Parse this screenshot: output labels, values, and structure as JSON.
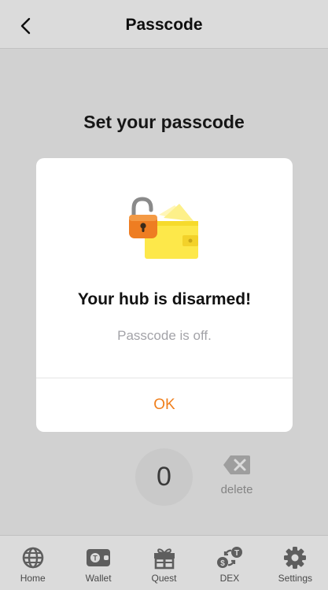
{
  "header": {
    "title": "Passcode",
    "back_icon": "chevron-left-icon"
  },
  "main": {
    "heading": "Set your passcode",
    "keypad": {
      "zero_label": "0",
      "delete_label": "delete",
      "delete_icon": "backspace-icon"
    }
  },
  "dialog": {
    "illustration": "unlocked-padlock-wallet-icon",
    "title": "Your hub is disarmed!",
    "message": "Passcode is off.",
    "ok_label": "OK"
  },
  "tabbar": {
    "items": [
      {
        "label": "Home",
        "icon": "globe-icon"
      },
      {
        "label": "Wallet",
        "icon": "wallet-icon"
      },
      {
        "label": "Quest",
        "icon": "gift-icon"
      },
      {
        "label": "DEX",
        "icon": "exchange-icon"
      },
      {
        "label": "Settings",
        "icon": "gear-icon"
      }
    ]
  },
  "colors": {
    "accent": "#f07f1c",
    "overlay": "rgba(0,0,0,0.14)",
    "lock_orange": "#ee7d22",
    "wallet_yellow": "#fde84a"
  }
}
